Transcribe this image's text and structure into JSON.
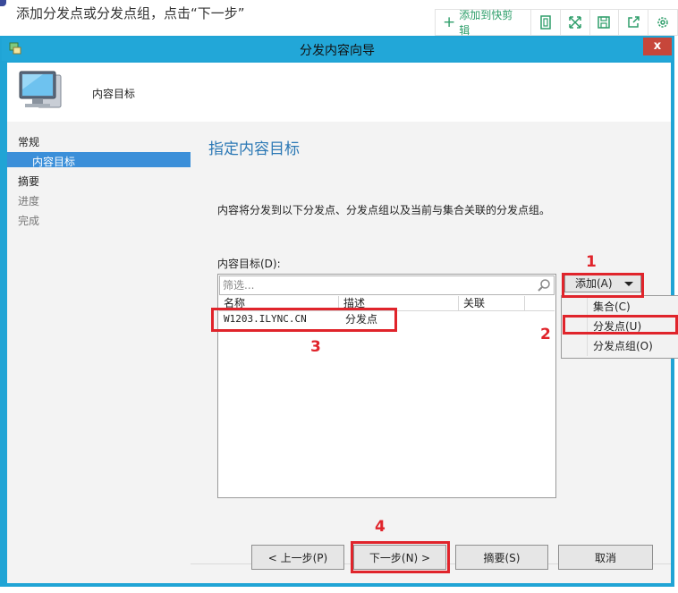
{
  "caption": "添加分发点或分发点组，点击“下一步”",
  "toolbar": {
    "add_label": "添加到快剪辑",
    "icons": [
      "plus-icon",
      "copy-icon",
      "expand-icon",
      "save-icon",
      "share-icon",
      "gear-icon"
    ]
  },
  "dialog": {
    "title": "分发内容向导",
    "close": "x",
    "header_label": "内容目标",
    "nav": [
      "常规",
      "内容目标",
      "摘要",
      "进度",
      "完成"
    ],
    "page_title": "指定内容目标",
    "description": "内容将分发到以下分发点、分发点组以及当前与集合关联的分发点组。",
    "targets_label": "内容目标(D):",
    "filter_placeholder": "筛选...",
    "columns": [
      "名称",
      "描述",
      "关联"
    ],
    "rows": [
      {
        "name": "W1203.ILYNC.CN",
        "description": "分发点",
        "association": ""
      }
    ],
    "add_button": "添加(A)",
    "add_menu": [
      "集合(C)",
      "分发点(U)",
      "分发点组(O)"
    ],
    "buttons": {
      "prev": "< 上一步(P)",
      "next": "下一步(N) >",
      "summary": "摘要(S)",
      "cancel": "取消"
    }
  },
  "annotations": {
    "step1": "1",
    "step2": "2",
    "step3": "3",
    "step4": "4",
    "color": "#e0242b"
  },
  "colors": {
    "titlebar": "#22a7d8",
    "nav_active": "#3b8fd9",
    "page_title": "#2b78b5"
  }
}
